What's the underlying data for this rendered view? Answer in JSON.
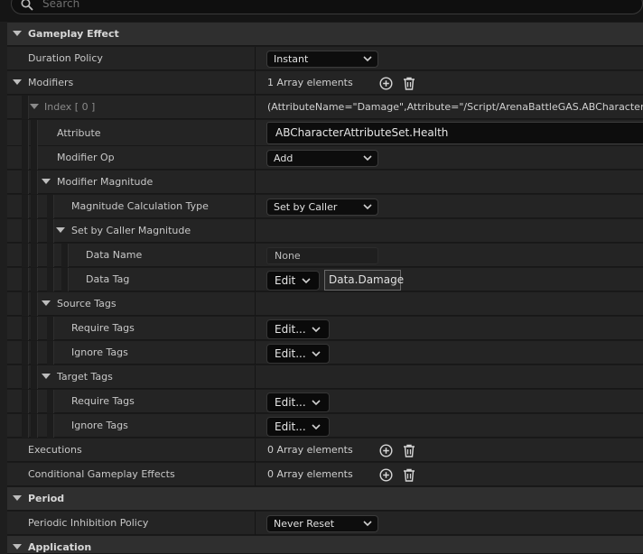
{
  "search": {
    "placeholder": "Search"
  },
  "rows": {
    "gameplay_effect": {
      "label": "Gameplay Effect"
    },
    "duration_policy": {
      "label": "Duration Policy",
      "value": "Instant"
    },
    "modifiers": {
      "label": "Modifiers",
      "value": "1 Array elements"
    },
    "index0": {
      "label": "Index [ 0 ]",
      "value": "(AttributeName=\"Damage\",Attribute=\"/Script/ArenaBattleGAS.ABCharacterAttributeSet"
    },
    "attribute": {
      "label": "Attribute",
      "value": "ABCharacterAttributeSet.Health"
    },
    "modifier_op": {
      "label": "Modifier Op",
      "value": "Add"
    },
    "modifier_magnitude": {
      "label": "Modifier Magnitude"
    },
    "magnitude_calc_type": {
      "label": "Magnitude Calculation Type",
      "value": "Set by Caller"
    },
    "set_by_caller": {
      "label": "Set by Caller Magnitude"
    },
    "data_name": {
      "label": "Data Name",
      "value": "None"
    },
    "data_tag": {
      "label": "Data Tag",
      "button": "Edit",
      "tag": "Data.Damage"
    },
    "source_tags": {
      "label": "Source Tags"
    },
    "source_require": {
      "label": "Require Tags",
      "button": "Edit..."
    },
    "source_ignore": {
      "label": "Ignore Tags",
      "button": "Edit..."
    },
    "target_tags": {
      "label": "Target Tags"
    },
    "target_require": {
      "label": "Require Tags",
      "button": "Edit..."
    },
    "target_ignore": {
      "label": "Ignore Tags",
      "button": "Edit..."
    },
    "executions": {
      "label": "Executions",
      "value": "0 Array elements"
    },
    "conditional": {
      "label": "Conditional Gameplay Effects",
      "value": "0 Array elements"
    },
    "period": {
      "label": "Period"
    },
    "periodic_inhibition": {
      "label": "Periodic Inhibition Policy",
      "value": "Never Reset"
    },
    "application": {
      "label": "Application"
    }
  },
  "icons": {
    "add": "add-circle-icon",
    "delete": "trash-icon",
    "expand": "triangle-down-icon",
    "dropdown": "chevron-down-icon",
    "search": "search-icon"
  }
}
